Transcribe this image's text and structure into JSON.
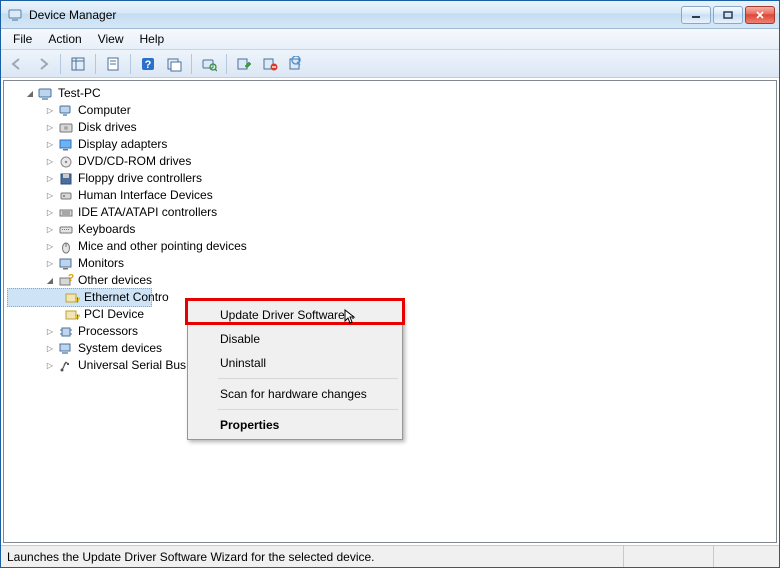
{
  "window": {
    "title": "Device Manager"
  },
  "menu": {
    "file": "File",
    "action": "Action",
    "view": "View",
    "help": "Help"
  },
  "tree": {
    "root": "Test-PC",
    "nodes": {
      "computer": "Computer",
      "disk_drives": "Disk drives",
      "display_adapters": "Display adapters",
      "dvd_cdrom": "DVD/CD-ROM drives",
      "floppy": "Floppy drive controllers",
      "hid": "Human Interface Devices",
      "ide": "IDE ATA/ATAPI controllers",
      "keyboards": "Keyboards",
      "mice": "Mice and other pointing devices",
      "monitors": "Monitors",
      "other_devices": "Other devices",
      "ethernet_controller": "Ethernet Contro",
      "pci_device": "PCI Device",
      "processors": "Processors",
      "system_devices": "System devices",
      "usb": "Universal Serial Bus"
    }
  },
  "context_menu": {
    "update_driver": "Update Driver Software...",
    "disable": "Disable",
    "uninstall": "Uninstall",
    "scan": "Scan for hardware changes",
    "properties": "Properties"
  },
  "statusbar": {
    "text": "Launches the Update Driver Software Wizard for the selected device."
  }
}
